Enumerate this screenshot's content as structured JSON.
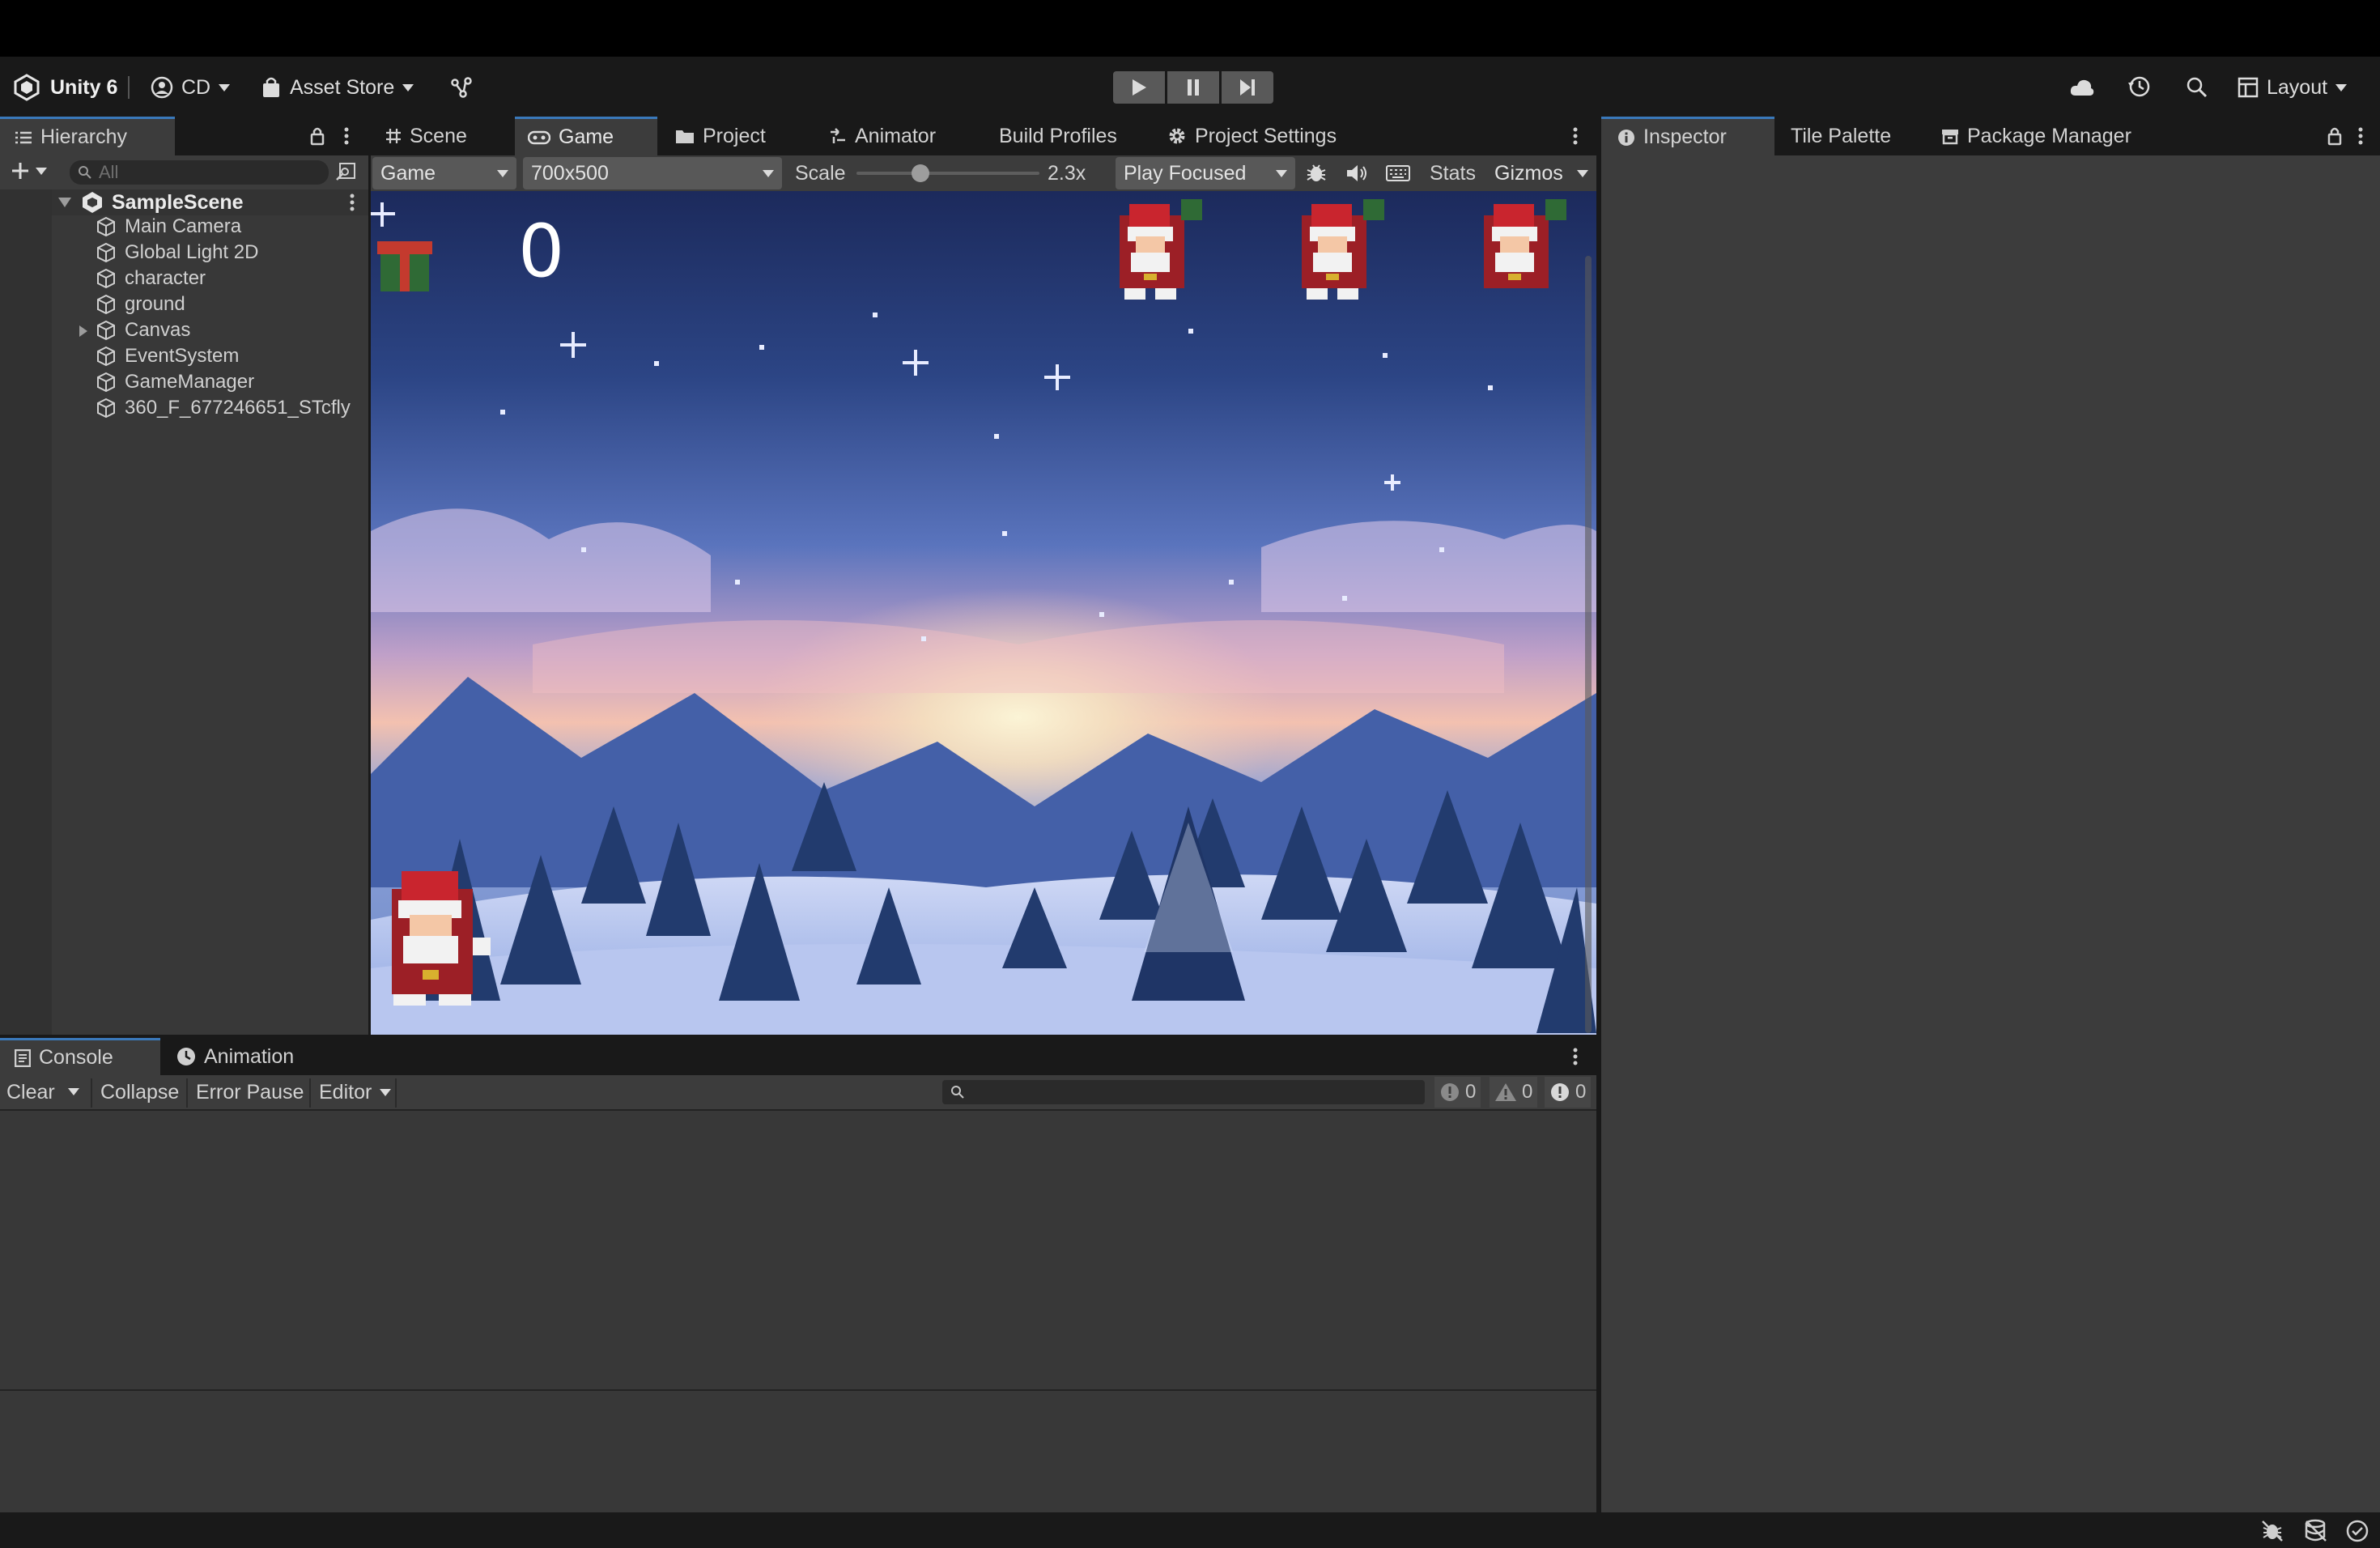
{
  "toolbar": {
    "unity_label": "Unity 6",
    "account_label": "CD",
    "asset_store_label": "Asset Store",
    "layout_label": "Layout"
  },
  "hierarchy": {
    "tab_label": "Hierarchy",
    "search_placeholder": "All",
    "scene_name": "SampleScene",
    "items": [
      {
        "label": "Main Camera"
      },
      {
        "label": "Global Light 2D"
      },
      {
        "label": "character"
      },
      {
        "label": "ground"
      },
      {
        "label": "Canvas"
      },
      {
        "label": "EventSystem"
      },
      {
        "label": "GameManager"
      },
      {
        "label": "360_F_677246651_STcfly"
      }
    ]
  },
  "center_tabs": [
    {
      "label": "Scene"
    },
    {
      "label": "Game"
    },
    {
      "label": "Project"
    },
    {
      "label": "Animator"
    },
    {
      "label": "Build Profiles"
    },
    {
      "label": "Project Settings"
    }
  ],
  "game_toolbar": {
    "display_label": "Game",
    "resolution_label": "700x500",
    "scale_label": "Scale",
    "scale_value": "2.3x",
    "scale_fraction": 0.35,
    "play_mode_label": "Play Focused",
    "stats_label": "Stats",
    "gizmos_label": "Gizmos"
  },
  "game_view": {
    "score": "0"
  },
  "right_tabs": [
    {
      "label": "Inspector"
    },
    {
      "label": "Tile Palette"
    },
    {
      "label": "Package Manager"
    }
  ],
  "bottom_tabs": [
    {
      "label": "Console"
    },
    {
      "label": "Animation"
    }
  ],
  "console": {
    "clear_label": "Clear",
    "collapse_label": "Collapse",
    "error_pause_label": "Error Pause",
    "editor_label": "Editor",
    "log_count": "0",
    "warning_count": "0",
    "error_count": "0"
  },
  "colors": {
    "accent": "#3a79bb",
    "background": "#282828",
    "header": "#191919",
    "panel": "#3c3c3c"
  }
}
